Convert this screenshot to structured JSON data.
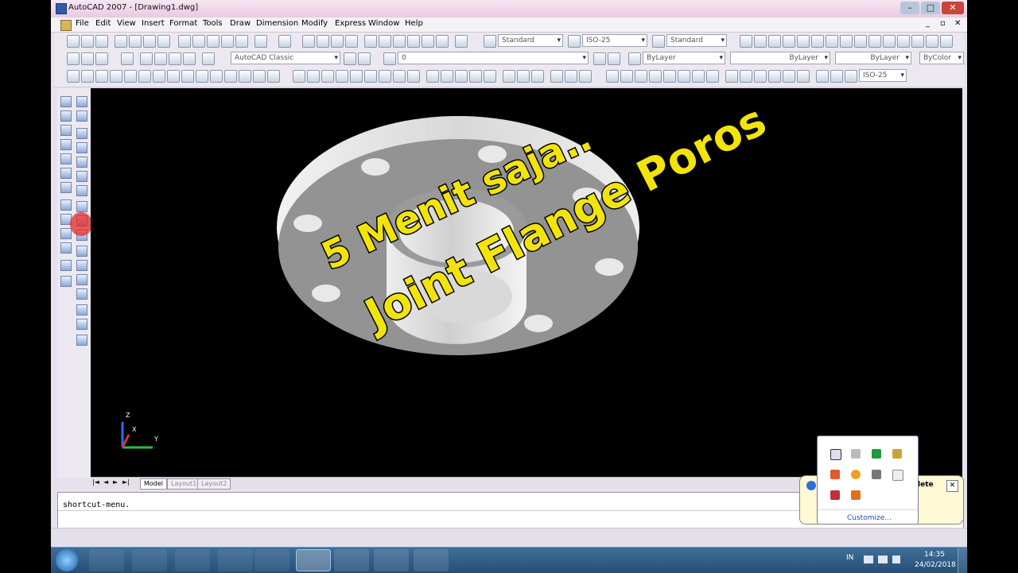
{
  "window": {
    "title": "AutoCAD 2007 - [Drawing1.dwg]"
  },
  "menu": [
    "File",
    "Edit",
    "View",
    "Insert",
    "Format",
    "Tools",
    "Draw",
    "Dimension",
    "Modify",
    "Express",
    "Window",
    "Help"
  ],
  "toolbar": {
    "text_style": "Standard",
    "dim_style": "ISO-25",
    "table_style": "Standard",
    "workspace": "AutoCAD Classic",
    "layer": "0",
    "color": "ByLayer",
    "linetype": "ByLayer",
    "lineweight": "ByLayer",
    "plotstyle": "ByColor",
    "dim_style_small": "ISO-25"
  },
  "tabs": {
    "model": "Model",
    "layout1": "Layout1",
    "layout2": "Layout2"
  },
  "command_line": "shortcut-menu.",
  "overlay": {
    "line1": "5 Menit saja..",
    "line2": "Joint Flange Poros"
  },
  "tray": {
    "customize": "Customize...",
    "balloon_fragment": "lete"
  },
  "taskbar": {
    "language": "IN",
    "time": "14:35",
    "date": "24/02/2018"
  },
  "axes": {
    "x": "X",
    "y": "Y",
    "z": "Z"
  }
}
